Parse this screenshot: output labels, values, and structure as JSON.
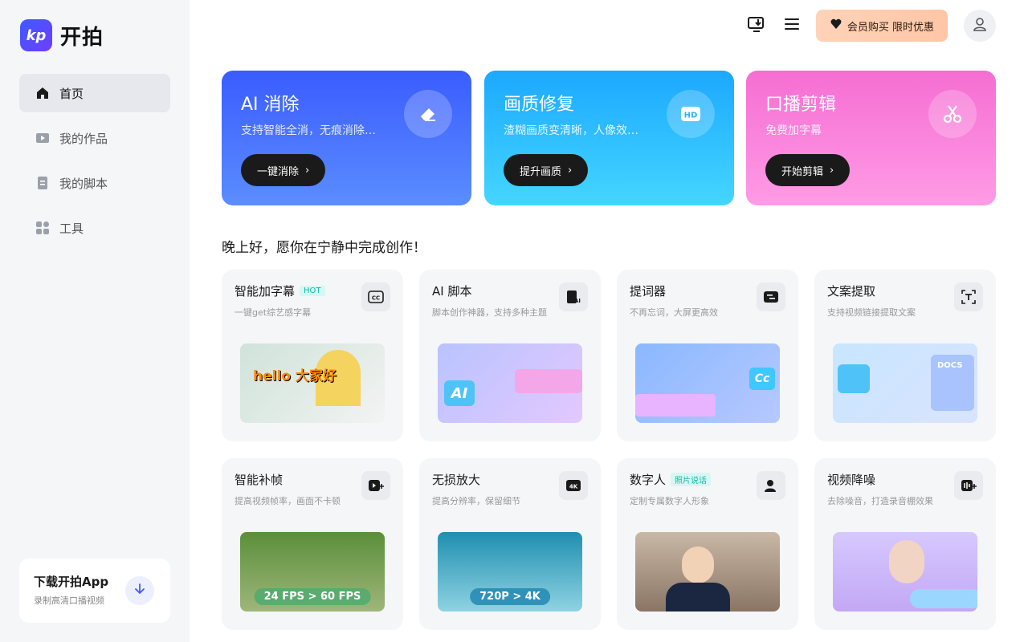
{
  "app": {
    "logo_text": "开拍",
    "logo_mark": "kp"
  },
  "sidebar": {
    "items": [
      {
        "label": "首页",
        "icon": "home-icon",
        "active": true
      },
      {
        "label": "我的作品",
        "icon": "play-box-icon",
        "active": false
      },
      {
        "label": "我的脚本",
        "icon": "document-icon",
        "active": false
      },
      {
        "label": "工具",
        "icon": "grid-icon",
        "active": false
      }
    ],
    "download": {
      "title": "下载开拍App",
      "subtitle": "录制高清口播视频"
    }
  },
  "header": {
    "vip_label": "会员购买 限时优惠"
  },
  "hero": [
    {
      "title": "AI 消除",
      "subtitle": "支持智能全消，无痕消除…",
      "button": "一键消除",
      "icon": "eraser-icon"
    },
    {
      "title": "画质修复",
      "subtitle": "渣糊画质变清晰，人像效…",
      "button": "提升画质",
      "icon": "hd-icon"
    },
    {
      "title": "口播剪辑",
      "subtitle": "免费加字幕",
      "button": "开始剪辑",
      "icon": "scissors-icon"
    }
  ],
  "greeting": "晚上好，愿你在宁静中完成创作！",
  "tools": [
    {
      "title": "智能加字幕",
      "tag": "HOT",
      "subtitle": "一键get综艺感字幕",
      "icon": "cc-icon",
      "thumb_text": "hello 大家好"
    },
    {
      "title": "AI 脚本",
      "tag": "",
      "subtitle": "脚本创作神器，支持多种主题",
      "icon": "ai-script-icon",
      "thumb_text": "AI"
    },
    {
      "title": "提词器",
      "tag": "",
      "subtitle": "不再忘词，大屏更高效",
      "icon": "teleprompter-icon",
      "thumb_text": "Cc"
    },
    {
      "title": "文案提取",
      "tag": "",
      "subtitle": "支持视频链接提取文案",
      "icon": "text-extract-icon",
      "thumb_text": "DOCS"
    },
    {
      "title": "智能补帧",
      "tag": "",
      "subtitle": "提高视频帧率，画面不卡顿",
      "icon": "frame-icon",
      "thumb_text": "24 FPS > 60 FPS"
    },
    {
      "title": "无损放大",
      "tag": "",
      "subtitle": "提高分辨率，保留细节",
      "icon": "4k-icon",
      "thumb_text": "720P > 4K"
    },
    {
      "title": "数字人",
      "tag": "照片说话",
      "subtitle": "定制专属数字人形象",
      "icon": "digital-human-icon",
      "thumb_text": ""
    },
    {
      "title": "视频降噪",
      "tag": "",
      "subtitle": "去除噪音，打造录音棚效果",
      "icon": "denoise-icon",
      "thumb_text": ""
    }
  ]
}
